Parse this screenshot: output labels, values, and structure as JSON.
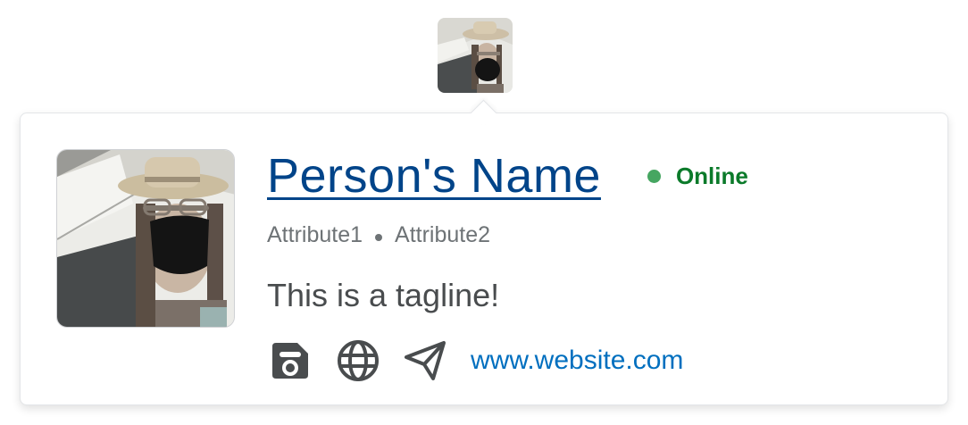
{
  "trigger": {
    "avatar_alt": "avatar"
  },
  "profile": {
    "name": "Person's Name",
    "status": "Online",
    "attributes": [
      "Attribute1",
      "Attribute2"
    ],
    "tagline": "This is a tagline!",
    "website": "www.website.com"
  },
  "icons": {
    "action_1": "voicemail-tape-icon",
    "action_2": "globe-icon",
    "action_3": "send-paper-plane-icon"
  },
  "colors": {
    "name_link": "#004489",
    "status_green": "#0b7a2a",
    "status_dot": "#46a661",
    "website_link": "#006fbf",
    "icon": "#494c4e"
  }
}
